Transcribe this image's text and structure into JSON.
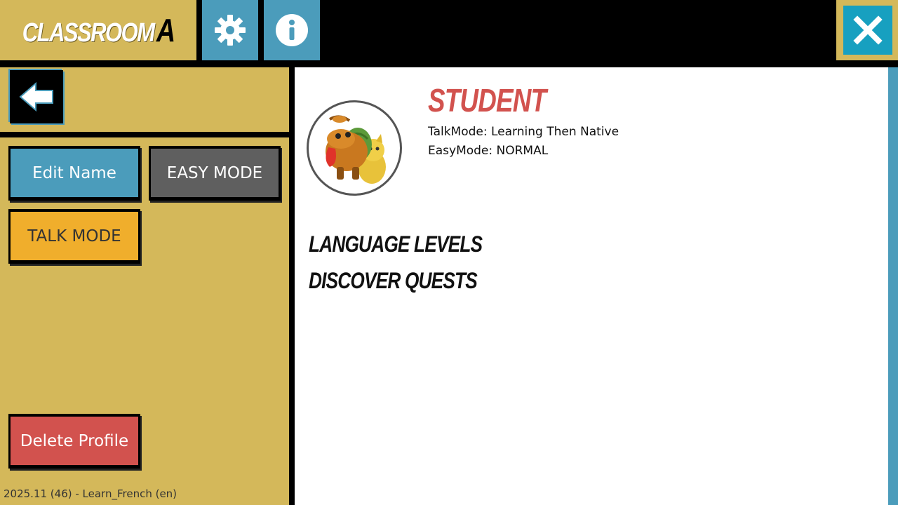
{
  "header": {
    "class_title": "CLASSROOM",
    "class_letter": "A",
    "settings_icon": "gear-icon",
    "info_icon": "info-icon",
    "close_icon": "close-icon"
  },
  "left_panel": {
    "back_icon": "arrow-left-icon",
    "buttons": {
      "edit_name": "Edit Name",
      "easy_mode": "EASY MODE",
      "talk_mode": "TALK MODE",
      "delete_profile": "Delete Profile"
    },
    "version": "2025.11 (46) - Learn_French (en)"
  },
  "profile": {
    "name": "STUDENT",
    "talk_mode": "TalkMode: Learning Then Native",
    "easy_mode": "EasyMode: NORMAL",
    "avatar": "character-avatar"
  },
  "sections": {
    "language_levels": "LANGUAGE LEVELS",
    "discover_quests": "DISCOVER QUESTS"
  },
  "colors": {
    "panel_gold": "#d4b85a",
    "accent_blue": "#4b9cbb",
    "close_cyan": "#17a0c0",
    "talk_orange": "#f0ae2c",
    "delete_red": "#d2524e",
    "easy_gray": "#5f5f5f",
    "name_red": "#d2524e"
  }
}
